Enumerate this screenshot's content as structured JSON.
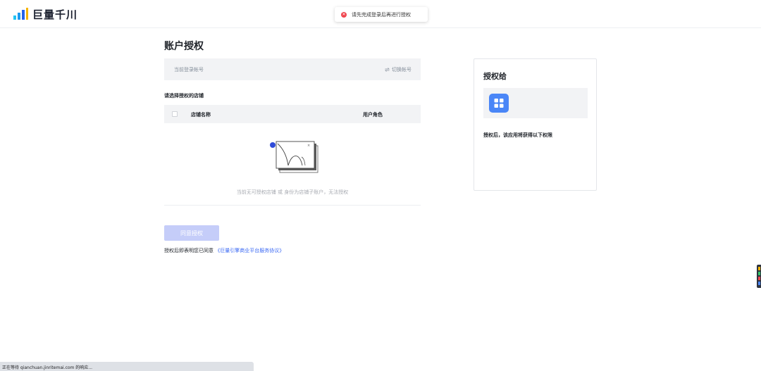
{
  "header": {
    "logo_text": "巨量千川"
  },
  "toast": {
    "icon": "error-icon",
    "message": "请先完成登录后再进行授权"
  },
  "page": {
    "title": "账户授权"
  },
  "account": {
    "label": "当前登录帐号",
    "switch_label": "切换帐号"
  },
  "store_select": {
    "label": "请选择授权的店铺",
    "columns": [
      "店铺名称",
      "用户角色"
    ],
    "rows": [],
    "empty_text": "当前无可授权店铺 或 身份为店铺子账户，无法授权"
  },
  "agreement": {
    "button_label": "同意授权",
    "note_prefix": "授权后即表明您已同意",
    "link_text": "《巨量引擎商业平台服务协议》"
  },
  "grant": {
    "title": "授权给",
    "app_icon": "grid-app-icon",
    "description": "授权后，该应用将获得以下权限"
  },
  "status_bar": {
    "text": "正在等待 qianchuan.jinritemai.com 的响应..."
  },
  "colors": {
    "primary": "#3a68f4",
    "button_disabled": "#c5cdf9",
    "error": "#f0454e",
    "app_icon": "#4a86f7"
  }
}
